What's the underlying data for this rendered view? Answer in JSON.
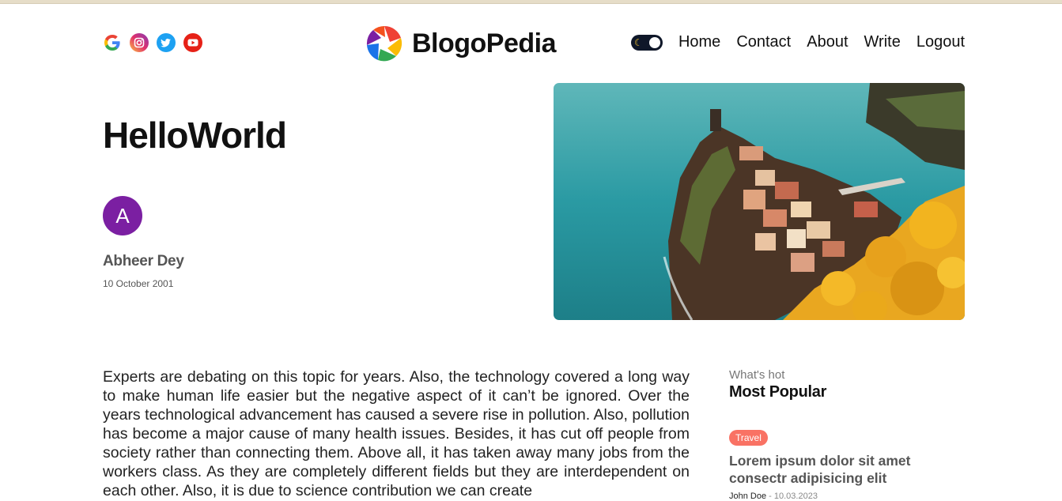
{
  "brand": {
    "name": "BlogoPedia"
  },
  "socials": [
    {
      "icon": "google-icon"
    },
    {
      "icon": "instagram-icon"
    },
    {
      "icon": "twitter-icon"
    },
    {
      "icon": "youtube-icon"
    }
  ],
  "nav": {
    "links": [
      "Home",
      "Contact",
      "About",
      "Write",
      "Logout"
    ],
    "theme_toggle_icon": "moon-icon"
  },
  "post": {
    "title": "HelloWorld",
    "author_initial": "A",
    "author_name": "Abheer Dey",
    "date": "10 October 2001",
    "body": "Experts are debating on this topic for years. Also, the technology covered a long way to make human life easier but the negative aspect of it can’t be ignored. Over the years technological advancement has caused a severe rise in pollution. Also, pollution has become a major cause of many health issues. Besides, it has cut off people from society rather than connecting them. Above all, it has taken away many jobs from the workers class. As they are completely different fields but they are interdependent on each other. Also, it is due to science contribution we can create"
  },
  "sidebar": {
    "subtitle": "What's hot",
    "title": "Most Popular",
    "items": [
      {
        "category": "Travel",
        "title": "Lorem ipsum dolor sit amet consectr adipisicing elit",
        "author": "John Doe",
        "date": "10.03.2023"
      }
    ]
  },
  "colors": {
    "avatar": "#7b1fa2",
    "badge_travel": "#f97264",
    "toggle_bg": "#0f1729"
  }
}
